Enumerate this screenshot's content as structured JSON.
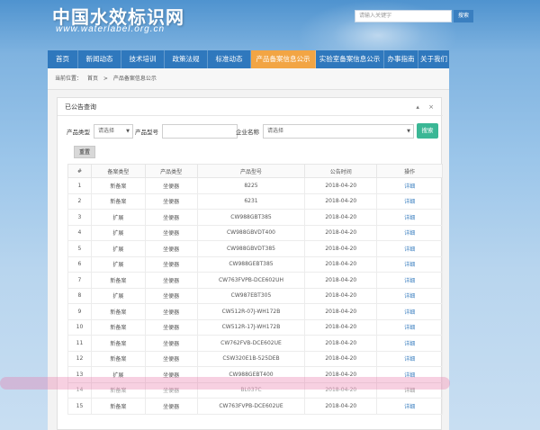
{
  "header": {
    "title": "中国水效标识网",
    "url": "www.waterlabel.org.cn",
    "search_placeholder": "请输入关键字",
    "search_button": "搜索"
  },
  "nav": {
    "items": [
      "首页",
      "新闻动态",
      "技术培训",
      "政策法规",
      "标准动态",
      "产品备案信息公示",
      "实验室备案信息公示",
      "办事指南",
      "关于我们"
    ],
    "active_index": 5
  },
  "breadcrumb": {
    "prefix": "当前位置：",
    "home": "首页",
    "separator": ">",
    "current": "产品备案信息公示"
  },
  "panel": {
    "title": "已公告查询",
    "tools": "▴ ×",
    "filters": {
      "category_label": "产品类型",
      "category_value": "请选择",
      "model_label": "产品型号",
      "model_value": "",
      "company_label": "企业名称",
      "company_value": "请选择",
      "query_button": "搜索",
      "reset_button": "重置"
    }
  },
  "table": {
    "columns": [
      "#",
      "备案类型",
      "产品类型",
      "产品型号",
      "公告时间",
      "操作"
    ],
    "rows": [
      [
        "1",
        "新备案",
        "坐便器",
        "8225",
        "2018-04-20",
        "详细"
      ],
      [
        "2",
        "新备案",
        "坐便器",
        "6231",
        "2018-04-20",
        "详细"
      ],
      [
        "3",
        "扩展",
        "坐便器",
        "CW988GBT385",
        "2018-04-20",
        "详细"
      ],
      [
        "4",
        "扩展",
        "坐便器",
        "CW988GBVDT400",
        "2018-04-20",
        "详细"
      ],
      [
        "5",
        "扩展",
        "坐便器",
        "CW988GBVDT385",
        "2018-04-20",
        "详细"
      ],
      [
        "6",
        "扩展",
        "坐便器",
        "CW988GEBT385",
        "2018-04-20",
        "详细"
      ],
      [
        "7",
        "新备案",
        "坐便器",
        "CW763FVPB-DCE602UH",
        "2018-04-20",
        "详细"
      ],
      [
        "8",
        "扩展",
        "坐便器",
        "CW987EBT305",
        "2018-04-20",
        "详细"
      ],
      [
        "9",
        "新备案",
        "坐便器",
        "CW512R-07J-WH172B",
        "2018-04-20",
        "详细"
      ],
      [
        "10",
        "新备案",
        "坐便器",
        "CW512R-17J-WH172B",
        "2018-04-20",
        "详细"
      ],
      [
        "11",
        "新备案",
        "坐便器",
        "CW762FVB-DCE602UE",
        "2018-04-20",
        "详细"
      ],
      [
        "12",
        "新备案",
        "坐便器",
        "CSW320E1B-525DEB",
        "2018-04-20",
        "详细"
      ],
      [
        "13",
        "扩展",
        "坐便器",
        "CW988GEBT400",
        "2018-04-20",
        "详细"
      ],
      [
        "14",
        "新备案",
        "坐便器",
        "BL037C",
        "2018-04-20",
        "详细"
      ],
      [
        "15",
        "新备案",
        "坐便器",
        "CW763FVPB-DCE602UE",
        "2018-04-20",
        "详细"
      ]
    ],
    "highlighted_row": 14
  },
  "colors": {
    "nav": "#2f78bd",
    "nav_active": "#f2a544",
    "query_button": "#3ab795",
    "link": "#3a7fc0",
    "highlight": "#e878aa"
  }
}
